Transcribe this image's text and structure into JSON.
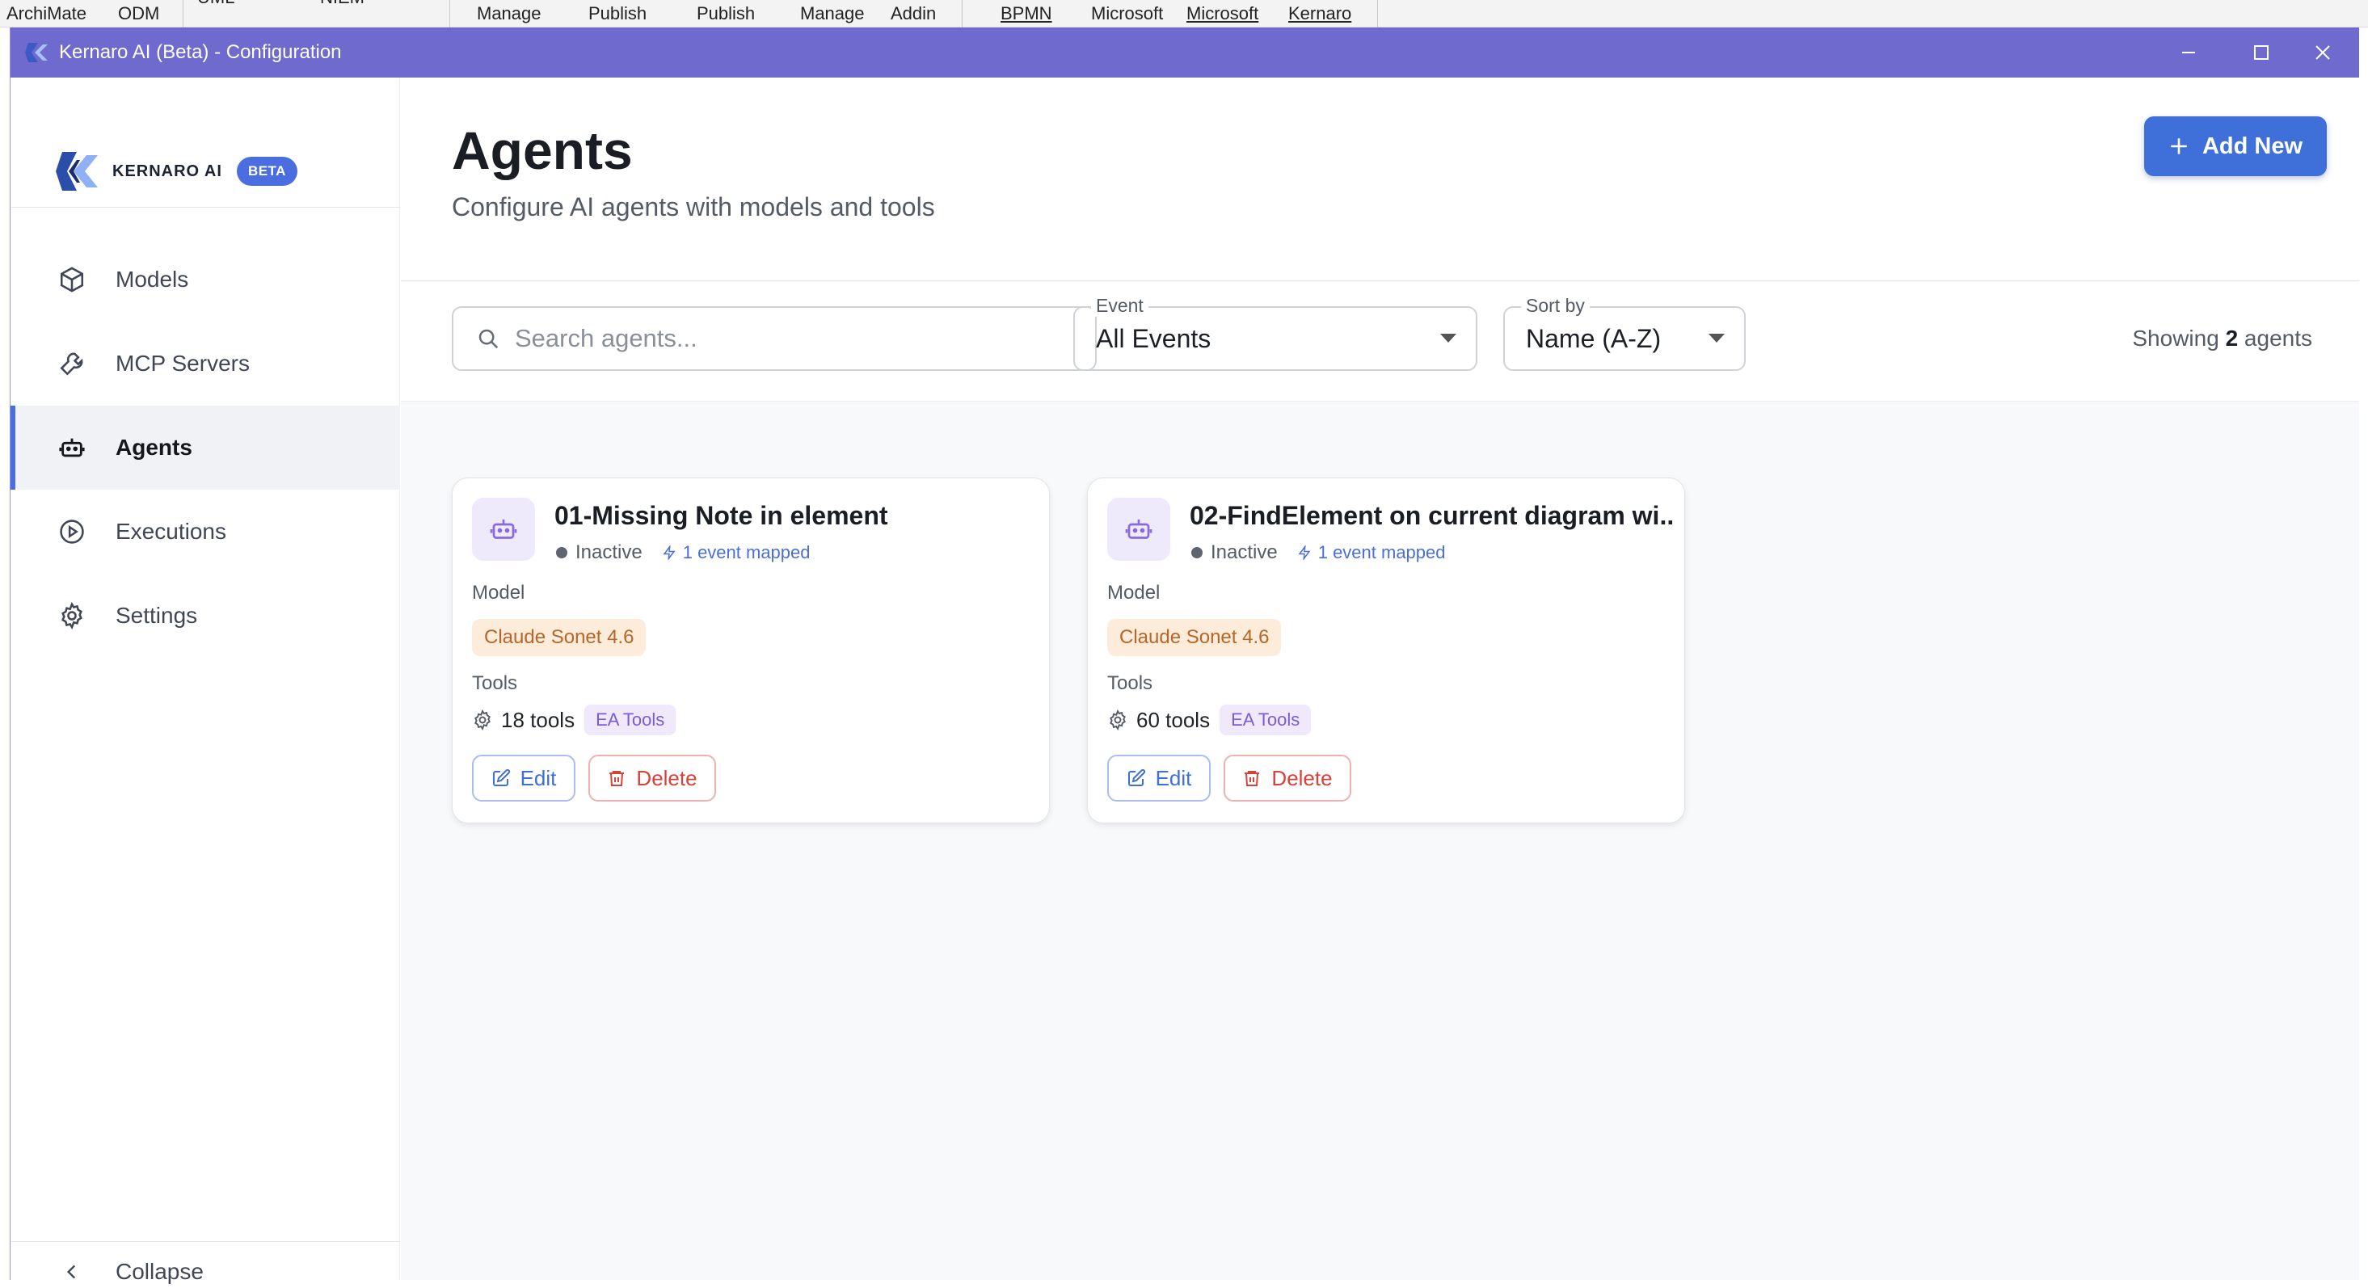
{
  "ribbon": {
    "items": [
      "ArchiMate",
      "ODM",
      "UML",
      "NIEM",
      "Manage",
      "Publish",
      "Publish",
      "Manage",
      "Addin",
      "BPMN",
      "Microsoft",
      "Microsoft",
      "Kernaro"
    ]
  },
  "window": {
    "title": "Kernaro AI (Beta) - Configuration",
    "controls": [
      "minimize",
      "maximize",
      "close"
    ]
  },
  "sidebar": {
    "logo_text": "KERNARO AI",
    "beta_badge": "BETA",
    "items": [
      {
        "label": "Models",
        "icon": "cube-icon",
        "active": false
      },
      {
        "label": "MCP Servers",
        "icon": "wrench-icon",
        "active": false
      },
      {
        "label": "Agents",
        "icon": "robot-icon",
        "active": true
      },
      {
        "label": "Executions",
        "icon": "play-circle-icon",
        "active": false
      },
      {
        "label": "Settings",
        "icon": "gear-icon",
        "active": false
      }
    ],
    "collapse_label": "Collapse"
  },
  "header": {
    "title": "Agents",
    "subtitle": "Configure AI agents with models and tools",
    "add_button": "Add New"
  },
  "filters": {
    "search_placeholder": "Search agents...",
    "event_label": "Event",
    "event_value": "All Events",
    "sort_label": "Sort by",
    "sort_value": "Name (A-Z)",
    "showing_prefix": "Showing",
    "showing_count": "2",
    "showing_suffix": "agents"
  },
  "agents": [
    {
      "name": "01-Missing Note in element",
      "status": "Inactive",
      "events": "1 event mapped",
      "model_label": "Model",
      "model": "Claude Sonet 4.6",
      "tools_label": "Tools",
      "tools_count": "18 tools",
      "tool_group": "EA Tools",
      "edit_label": "Edit",
      "delete_label": "Delete"
    },
    {
      "name": "02-FindElement on current diagram wi...",
      "status": "Inactive",
      "events": "1 event mapped",
      "model_label": "Model",
      "model": "Claude Sonet 4.6",
      "tools_label": "Tools",
      "tools_count": "60 tools",
      "tool_group": "EA Tools",
      "edit_label": "Edit",
      "delete_label": "Delete"
    }
  ],
  "colors": {
    "titlebar": "#6f6acd",
    "accent": "#3f6fd8",
    "model_chip_bg": "#fdecd9",
    "model_chip_text": "#b6662a",
    "delete": "#d6423a"
  }
}
